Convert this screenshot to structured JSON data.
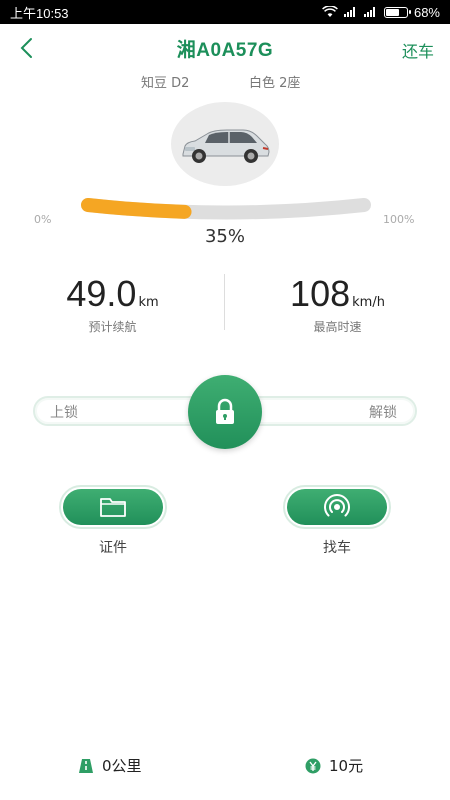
{
  "status_bar": {
    "time": "上午10:53",
    "battery": "68%",
    "battery_level": 0.68
  },
  "header": {
    "title": "湘A0A57G",
    "return_label": "还车"
  },
  "car": {
    "model": "知豆 D2",
    "color_seats": "白色 2座"
  },
  "battery_gauge": {
    "min_label": "0%",
    "max_label": "100%",
    "value_label": "35%",
    "level": 0.35,
    "fill_color": "#f5a623",
    "track_color": "#dedede"
  },
  "stats": {
    "range_value": "49.0",
    "range_unit": "km",
    "range_label": "预计续航",
    "speed_value": "108",
    "speed_unit": "km/h",
    "speed_label": "最高时速"
  },
  "lock_slider": {
    "lock_label": "上锁",
    "unlock_label": "解锁",
    "icon": "padlock-icon"
  },
  "actions": {
    "documents_label": "证件",
    "documents_icon": "folder-icon",
    "find_car_label": "找车",
    "find_car_icon": "signal-locate-icon"
  },
  "footer": {
    "distance": "0公里",
    "distance_icon": "road-icon",
    "cost": "10元",
    "cost_icon": "yen-coin-icon"
  },
  "colors": {
    "brand_green": "#1c8f5a",
    "button_green": "#2f9e65"
  }
}
